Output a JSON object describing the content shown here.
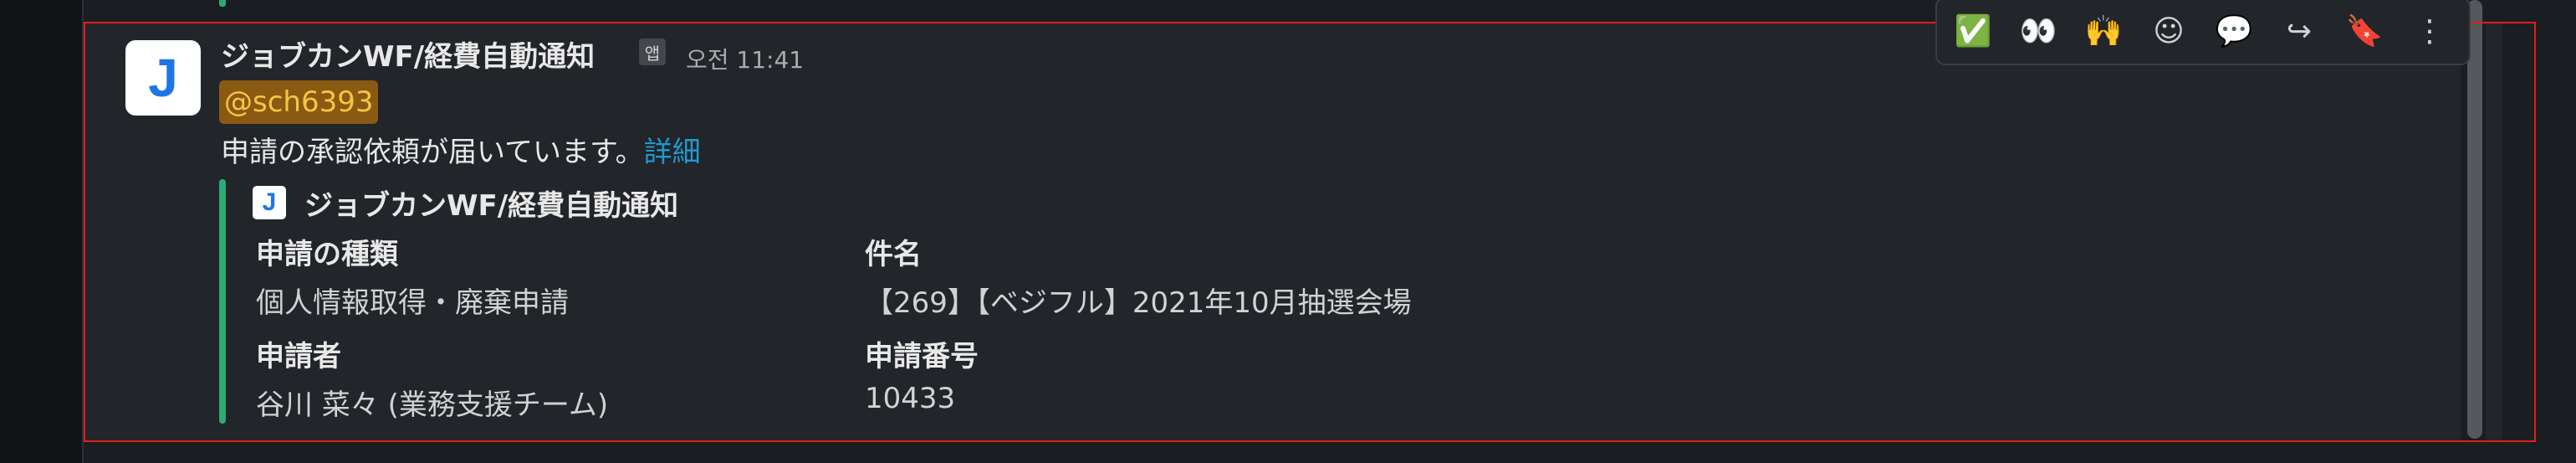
{
  "message": {
    "avatar_letter": "J",
    "sender": "ジョブカンWF/経費自動通知",
    "app_badge": "앱",
    "timestamp": "오전 11:41",
    "mention": "@sch6393",
    "body_text": "申請の承認依頼が届いています。",
    "body_link": "詳細"
  },
  "attachment": {
    "icon_letter": "J",
    "title": "ジョブカンWF/経費自動通知",
    "fields": [
      {
        "label": "申請の種類",
        "value": "個人情報取得・廃棄申請"
      },
      {
        "label": "件名",
        "value": "【269】【ベジフル】2021年10月抽選会場"
      },
      {
        "label": "申請者",
        "value": "谷川 菜々 (業務支援チーム)"
      },
      {
        "label": "申請番号",
        "value": "10433"
      }
    ]
  },
  "toolbar": {
    "buttons": [
      {
        "name": "check-mark-reaction",
        "glyph": "✅"
      },
      {
        "name": "eyes-reaction",
        "glyph": "👀"
      },
      {
        "name": "raised-hands-reaction",
        "glyph": "🙌"
      },
      {
        "name": "add-reaction",
        "glyph": "☺"
      },
      {
        "name": "reply-in-thread",
        "glyph": "💬"
      },
      {
        "name": "share-message",
        "glyph": "↪"
      },
      {
        "name": "save-for-later",
        "glyph": "🔖"
      },
      {
        "name": "more-actions",
        "glyph": "⋮"
      }
    ]
  },
  "colors": {
    "accent_green": "#2bac76",
    "link_blue": "#1d9bd1",
    "mention_bg": "#8a5a12",
    "mention_text": "#f2c744"
  }
}
